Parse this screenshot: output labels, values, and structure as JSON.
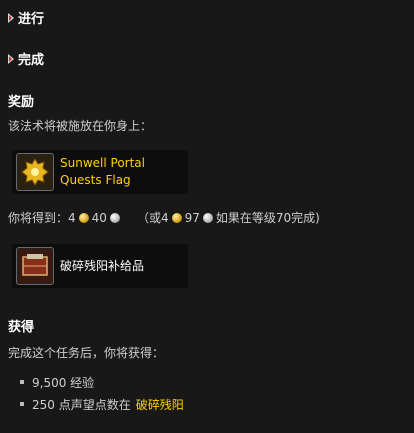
{
  "sections": {
    "progress_label": "进行",
    "complete_label": "完成"
  },
  "rewards": {
    "heading": "奖励",
    "spell_text": "该法术将被施放在你身上：",
    "spell_item": {
      "name_line1": "Sunwell Portal",
      "name_line2": "Quests Flag",
      "color": "#ffd100",
      "icon": "gold-gear-icon"
    },
    "receive_label": "你将得到：",
    "money": {
      "gold": "4",
      "silver": "40"
    },
    "alt_prefix": "（或4",
    "alt_silver": "97",
    "alt_suffix": "如果在等级70完成)",
    "item": {
      "name": "破碎残阳补给品",
      "color": "#ffffff",
      "icon": "supply-box-icon"
    }
  },
  "gains": {
    "heading": "获得",
    "intro": "完成这个任务后，你将获得：",
    "experience": "9,500 经验",
    "rep_prefix": "250 点声望点数在",
    "rep_faction": "破碎残阳"
  }
}
